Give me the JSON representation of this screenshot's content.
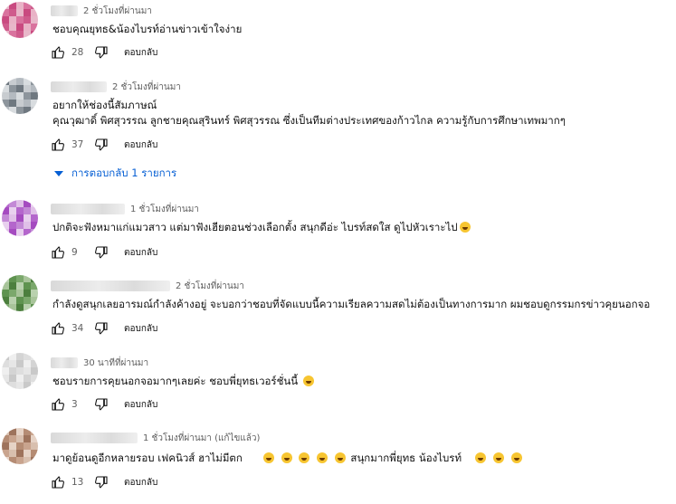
{
  "actions": {
    "reply_label": "ตอบกลับ"
  },
  "comments": [
    {
      "time": "2 ชั่วโมงที่ผ่านมา",
      "text": [
        "ชอบคุณยุทธ&น้องไบรท์อ่านข่าวเข้าใจง่าย"
      ],
      "likes": "28",
      "avatar_colors": [
        "#e8b7c9",
        "#d9739e",
        "#c94a80",
        "#cf5b8c",
        "#e9b2c6"
      ]
    },
    {
      "time": "2 ชั่วโมงที่ผ่านมา",
      "text": [
        "อยากให้ช่องนี้สัมภาษณ์",
        "คุณวุฒาดิ์ พิศสุวรรณ  ลูกชายคุณสุรินทร์ พิศสุวรรณ ซึ่งเป็นทีมต่างประเทศของก้าวไกล ความรู้กับการศึกษาเทพมากๆ"
      ],
      "likes": "37",
      "avatar_colors": [
        "#c8ccd0",
        "#8d959c",
        "#b4bac0",
        "#6f7880",
        "#d8dcdf"
      ]
    },
    {
      "time": "1 ชั่วโมงที่ผ่านมา",
      "text": [
        "ปกติจะฟังหมาแก่แมวสาว แต่มาฟังเฮียตอนช่วงเลือกตั้ง สนุกดีอ่ะ ไบรท์สดใส ดูไปหัวเราะไป"
      ],
      "likes": "9",
      "avatar_colors": [
        "#e0c0e8",
        "#b466cc",
        "#a54bc0",
        "#c389d6",
        "#e8d0ee"
      ]
    },
    {
      "time": "2 ชั่วโมงที่ผ่านมา",
      "text": [
        "กำลังดูสนุกเลยอารมณ์กำลังค้างอยู่ จะบอกว่าชอบที่จัดแบบนี้ความเรียลความสดไม่ต้องเป็นทางการมาก ผมชอบดูกรรมกรข่าวคุยนอกจอ"
      ],
      "likes": "34",
      "avatar_colors": [
        "#a8c49a",
        "#5f9350",
        "#4c7f3e",
        "#7ba86c",
        "#b9d1ae"
      ]
    },
    {
      "time": "30 นาทีที่ผ่านมา",
      "text": [
        "ชอบรายการคุยนอกจอมากๆเลยค่ะ ชอบพี่ยุทธเวอร์ชั่นนี้"
      ],
      "likes": "3",
      "avatar_colors": [
        "#e6e6e6",
        "#d4d4d4",
        "#c9c9c9",
        "#dedede",
        "#efefef"
      ]
    },
    {
      "time": "1 ชั่วโมงที่ผ่านมา (แก้ไขแล้ว)",
      "text": [
        "มาดูย้อนดูอีกหลายรอบ เฟคนิวส์  ฮาไม่มีตก",
        "สนุกมากพี่ยุทธ น้องไบรท์"
      ],
      "likes": "13",
      "avatar_colors": [
        "#d8bfae",
        "#b58c74",
        "#9e735c",
        "#c9a48e",
        "#e6d3c6"
      ]
    }
  ],
  "replies_toggle": {
    "label": "การตอบกลับ 1 รายการ"
  }
}
